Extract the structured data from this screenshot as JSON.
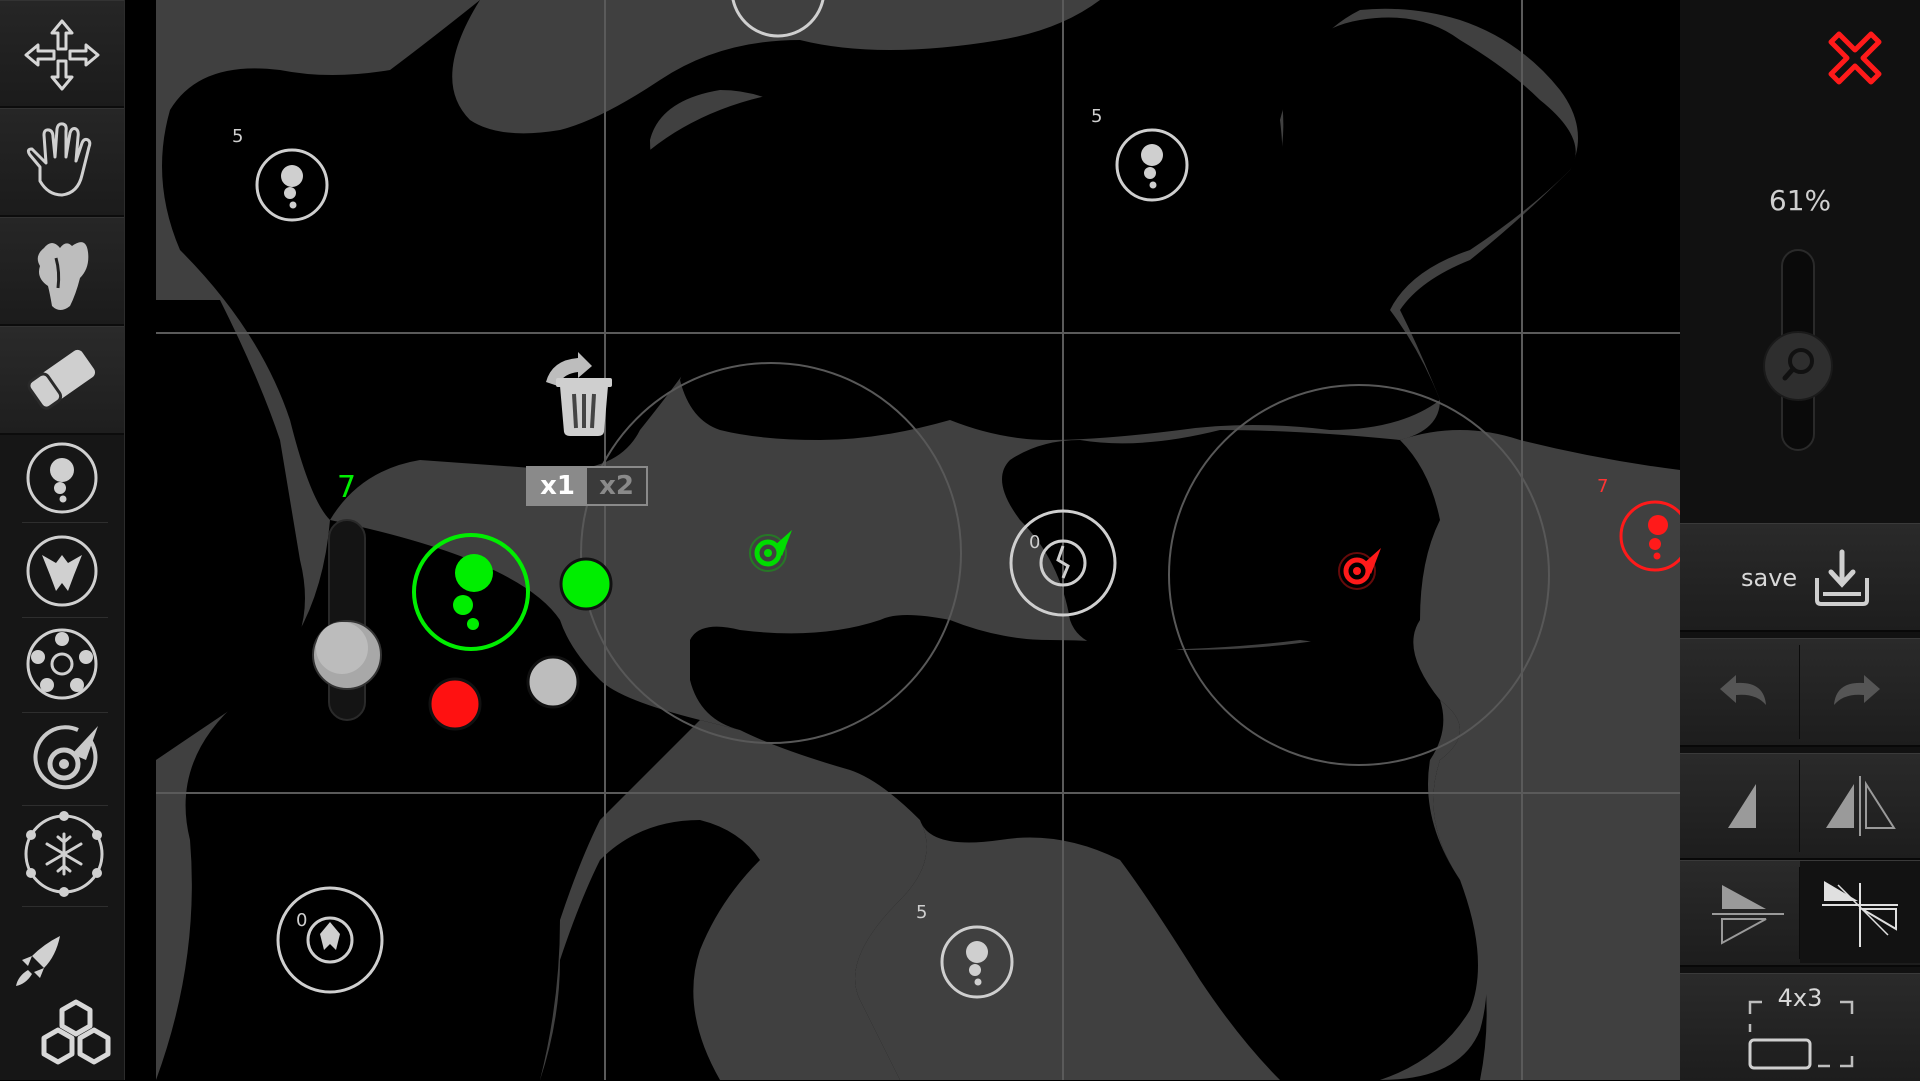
{
  "close": {
    "icon": "close-x-icon",
    "color": "#ff1a1a"
  },
  "zoom": {
    "value": "61%",
    "level_fraction": 0.5
  },
  "save": {
    "label": "save"
  },
  "grid": {
    "size_label": "4x3"
  },
  "multiplier": {
    "x1": "x1",
    "x2": "x2"
  },
  "green_player": {
    "unit_count": "7",
    "color": "#00ee00"
  },
  "red_player": {
    "unit_count": "7",
    "color": "#ff1a1a"
  },
  "bases": [
    {
      "count": "5"
    },
    {
      "count": "5"
    },
    {
      "count": "5"
    },
    {
      "count": "0"
    },
    {
      "count": "0"
    }
  ],
  "tools_left": [
    "move-arrows-icon",
    "hand-icon",
    "smudge-hand-icon",
    "eraser-icon",
    "unit-base-icon",
    "warrior-base-icon",
    "turret-base-icon",
    "missile-base-icon",
    "freeze-base-icon",
    "rocket-icon",
    "cluster-icon"
  ],
  "tools_right": [
    "undo-icon",
    "redo-icon",
    "single-triangle-icon",
    "mirror-horizontal-icon",
    "mirror-vertical-icon",
    "mirror-quad-icon",
    "download-icon",
    "zoom-slider-icon"
  ]
}
